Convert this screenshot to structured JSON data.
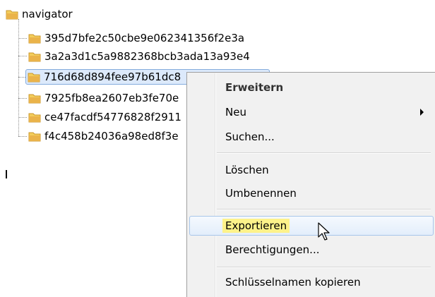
{
  "tree": {
    "root": {
      "label": "navigator"
    },
    "children": [
      {
        "label": "395d7bfe2c50cbe9e062341356f2e3a"
      },
      {
        "label": "3a2a3d1c5a9882368bcb3ada13a93e4"
      },
      {
        "label": "716d68d894fee97b61dc8"
      },
      {
        "label": "7925fb8ea2607eb3fe70e"
      },
      {
        "label": "ce47facdf54776828f2911"
      },
      {
        "label": "f4c458b24036a98ed8f3e"
      }
    ],
    "selected_index": 2
  },
  "context_menu": {
    "items": [
      {
        "label": "Erweitern",
        "default": true
      },
      {
        "label": "Neu",
        "submenu": true
      },
      {
        "label": "Suchen..."
      },
      {
        "label": "Löschen"
      },
      {
        "label": "Umbenennen"
      },
      {
        "label": "Exportieren",
        "highlighted": true
      },
      {
        "label": "Berechtigungen..."
      },
      {
        "label": "Schlüsselnamen kopieren"
      }
    ]
  },
  "colors": {
    "folder": "#e8b84a",
    "selection": "#dce9fb",
    "highlight": "#fdf28a",
    "menu_bg": "#f1f1f1"
  },
  "icons": {
    "folder": "folder-icon",
    "submenu_arrow": "chevron-right-icon",
    "cursor": "mouse-cursor-icon"
  }
}
